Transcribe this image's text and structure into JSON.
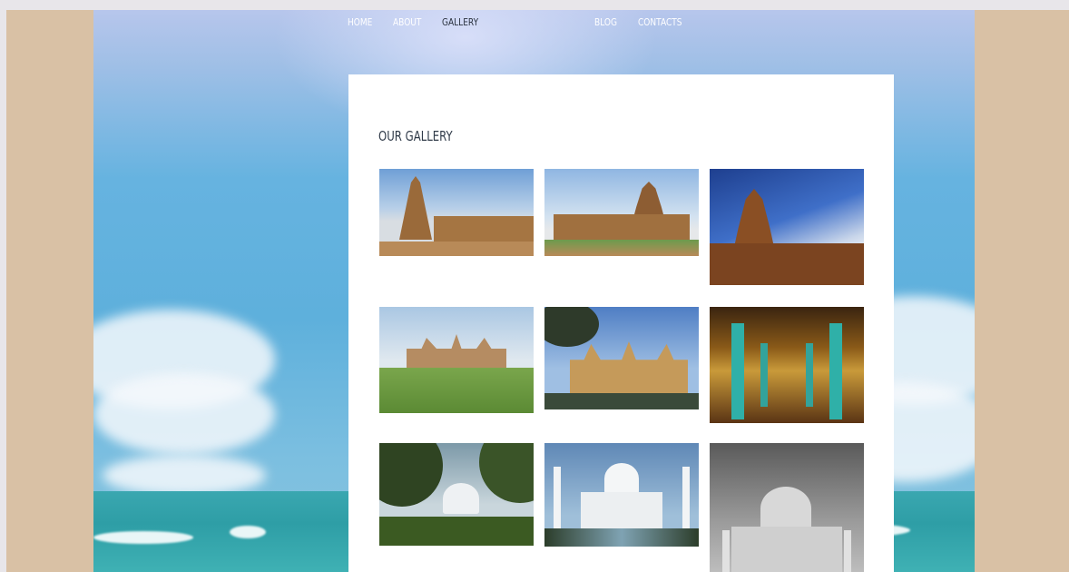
{
  "nav": {
    "items": [
      {
        "label": "HOME",
        "active": false
      },
      {
        "label": "ABOUT",
        "active": false
      },
      {
        "label": "GALLERY",
        "active": true
      },
      {
        "label": "BLOG",
        "active": false
      },
      {
        "label": "CONTACTS",
        "active": false
      }
    ]
  },
  "gallery": {
    "title": "OUR GALLERY",
    "images": [
      {
        "subject": "temple-tower"
      },
      {
        "subject": "temple-tower"
      },
      {
        "subject": "temple-tower"
      },
      {
        "subject": "palace"
      },
      {
        "subject": "palace"
      },
      {
        "subject": "palace-hall"
      },
      {
        "subject": "taj-mahal"
      },
      {
        "subject": "taj-mahal"
      },
      {
        "subject": "taj-mahal-bw"
      }
    ]
  },
  "colors": {
    "side_background": "#d9c1a5",
    "card": "#ffffff",
    "nav_text": "#ffffff",
    "nav_active": "#2b3340",
    "heading": "#2f3a48"
  }
}
